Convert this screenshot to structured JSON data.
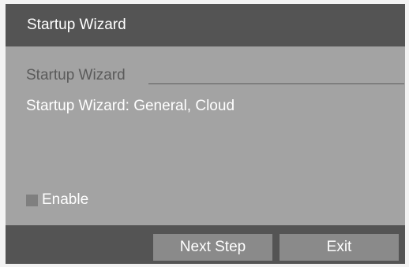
{
  "window": {
    "title": "Startup Wizard"
  },
  "content": {
    "section_label": "Startup Wizard",
    "summary": "Startup Wizard: General, Cloud",
    "enable": {
      "label": "Enable",
      "checked": false
    }
  },
  "footer": {
    "next_label": "Next Step",
    "exit_label": "Exit"
  },
  "colors": {
    "title_bar": "#545454",
    "content_bg": "#a3a3a3",
    "button_bg": "#8a8a8a",
    "section_label_text": "#5b5b5b",
    "text": "#ffffff"
  }
}
